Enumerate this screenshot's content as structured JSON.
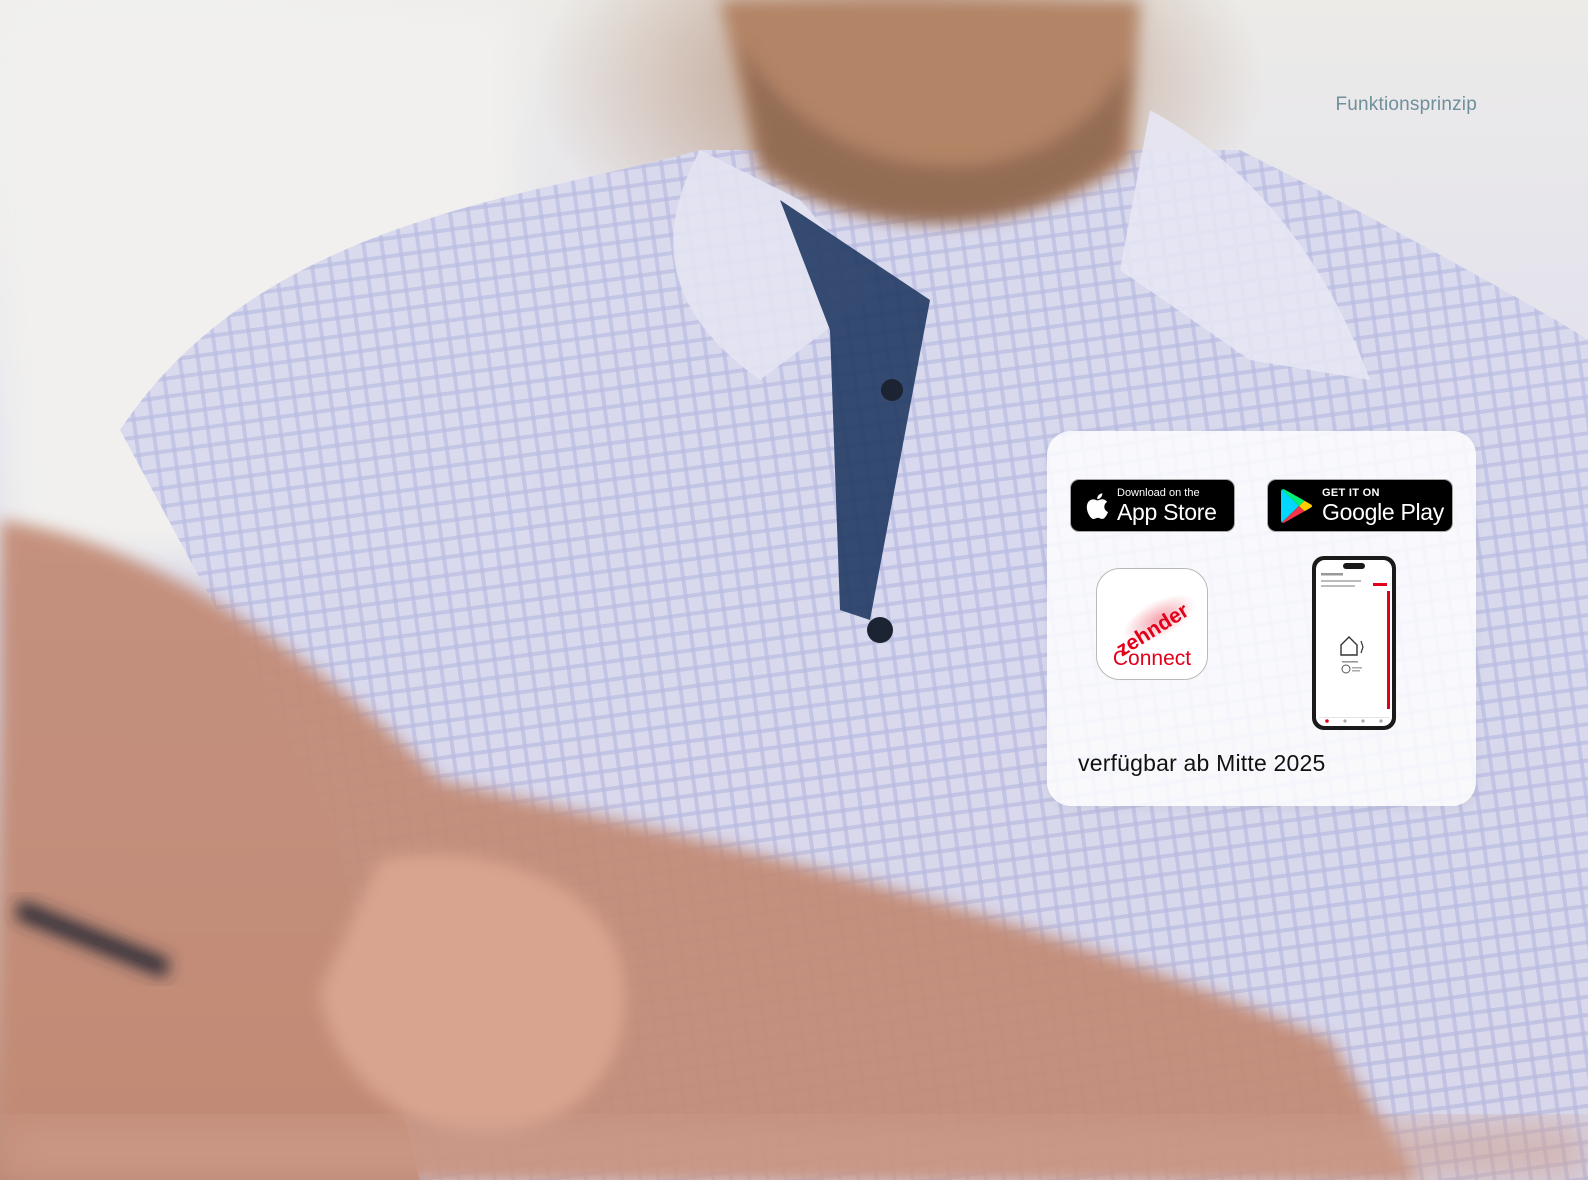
{
  "page": {
    "section_label": "Funktionsprinzip"
  },
  "photo": {
    "icon": "person-photo"
  },
  "app_card": {
    "appstore": {
      "small": "Download on the",
      "big": "App Store",
      "icon": "apple-icon"
    },
    "googleplay": {
      "small": "GET IT ON",
      "big": "Google Play",
      "icon": "google-play-icon"
    },
    "app_icon": {
      "wordmark": "zehnder",
      "name": "Connect",
      "color": "#e2001a"
    },
    "phone": {
      "icon": "smartphone-app-preview"
    },
    "availability": "verfügbar ab Mitte 2025"
  }
}
